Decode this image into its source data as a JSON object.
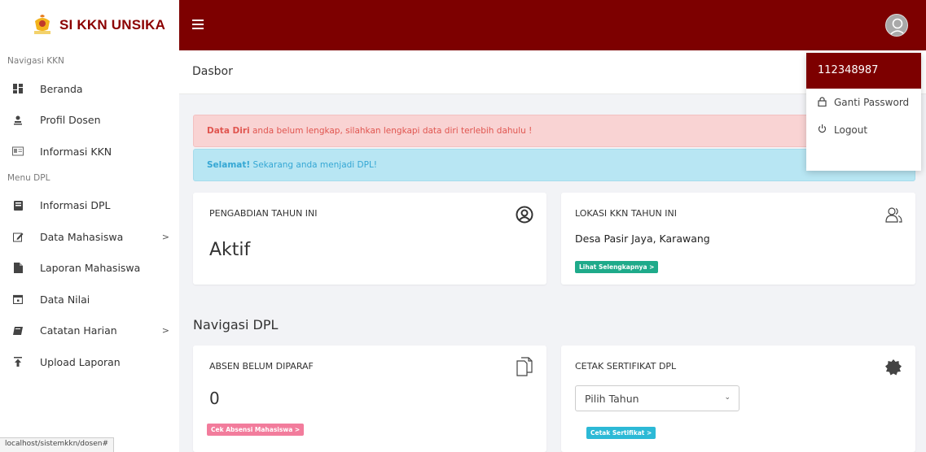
{
  "brand": {
    "name": "SI KKN UNSIKA"
  },
  "sidebar": {
    "header1": "Navigasi KKN",
    "header2": "Menu DPL",
    "items": [
      {
        "label": "Beranda",
        "icon": "dashboard-icon"
      },
      {
        "label": "Profil Dosen",
        "icon": "user-icon"
      },
      {
        "label": "Informasi KKN",
        "icon": "id-card-icon"
      },
      {
        "label": "Informasi DPL",
        "icon": "book-icon"
      },
      {
        "label": "Data Mahasiswa",
        "icon": "edit-icon",
        "chevron": ">"
      },
      {
        "label": "Laporan Mahasiswa",
        "icon": "file-icon"
      },
      {
        "label": "Data Nilai",
        "icon": "calendar-icon"
      },
      {
        "label": "Catatan Harian",
        "icon": "notebook-icon",
        "chevron": ">"
      },
      {
        "label": "Upload Laporan",
        "icon": "upload-icon"
      }
    ]
  },
  "status_url": "localhost/sistemkkn/dosen#",
  "page": {
    "title": "Dasbor"
  },
  "user_menu": {
    "username": "112348987",
    "items": [
      {
        "label": "Ganti Password",
        "icon": "lock-icon"
      },
      {
        "label": "Logout",
        "icon": "power-icon"
      }
    ]
  },
  "alerts": {
    "danger": {
      "strong": "Data Diri",
      "text": " anda belum lengkap, silahkan lengkapi data diri terlebih dahulu !"
    },
    "info": {
      "strong": "Selamat!",
      "text": " Sekarang anda menjadi DPL!",
      "close": "×"
    }
  },
  "cards": {
    "pengabdian": {
      "title": "PENGABDIAN TAHUN INI",
      "value": "Aktif"
    },
    "lokasi": {
      "title": "LOKASI KKN TAHUN INI",
      "value": "Desa Pasir Jaya, Karawang",
      "button": "Lihat Selengkapnya >"
    },
    "absen": {
      "title": "ABSEN BELUM DIPARAF",
      "value": "0",
      "button": "Cek Absensi Mahasiswa >"
    },
    "sertifikat": {
      "title": "CETAK SERTIFIKAT DPL",
      "select_value": "Pilih Tahun",
      "button": "Cetak Sertifikat >"
    }
  },
  "section_title": "Navigasi DPL",
  "colors": {
    "primary": "#7d0000",
    "danger_bg": "#f9d3d3",
    "info_bg": "#b8e6f3",
    "green": "#1eaa8a",
    "pink": "#f27c9c",
    "cyan": "#2cb9d6"
  }
}
